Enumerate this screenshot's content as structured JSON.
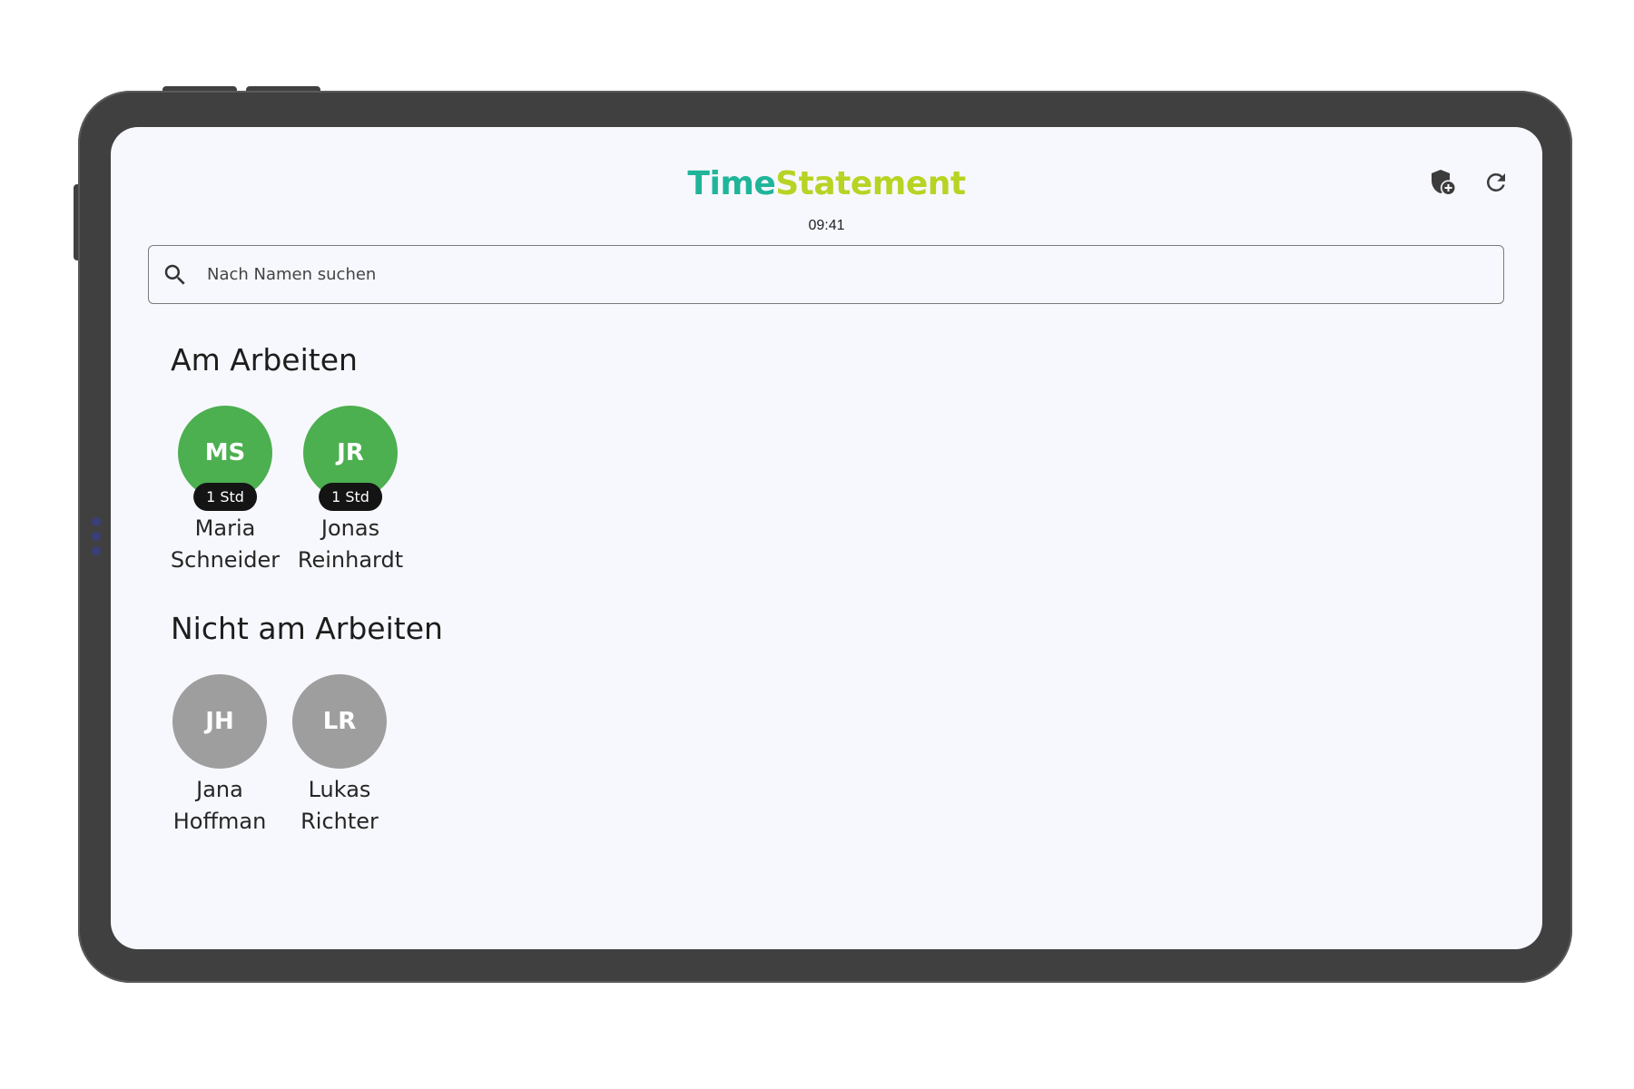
{
  "app": {
    "brand_part1": "Time",
    "brand_part2": "Statement",
    "clock": "09:41",
    "brand_colors": {
      "time": "#1fb59a",
      "statement": "#b8d323"
    }
  },
  "actions": {
    "admin_icon": "shield-add-icon",
    "refresh_icon": "refresh-icon"
  },
  "search": {
    "placeholder": "Nach Namen suchen",
    "value": "",
    "icon": "search-icon"
  },
  "working": {
    "title": "Am Arbeiten",
    "color": "#4caf50",
    "people": [
      {
        "initials": "MS",
        "first": "Maria",
        "last": "Schneider",
        "duration": "1 Std"
      },
      {
        "initials": "JR",
        "first": "Jonas",
        "last": "Reinhardt",
        "duration": "1 Std"
      }
    ]
  },
  "not_working": {
    "title": "Nicht am Arbeiten",
    "color": "#9e9e9e",
    "people": [
      {
        "initials": "JH",
        "first": "Jana",
        "last": "Hoffman"
      },
      {
        "initials": "LR",
        "first": "Lukas",
        "last": "Richter"
      }
    ]
  }
}
